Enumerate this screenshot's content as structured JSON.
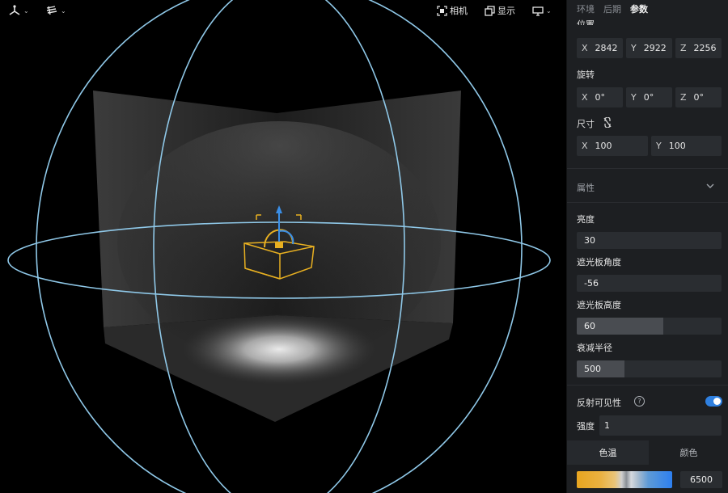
{
  "toolbar": {
    "camera_label": "相机",
    "display_label": "显示"
  },
  "panel": {
    "tabs": [
      {
        "label": "环境",
        "active": false
      },
      {
        "label": "后期",
        "active": false
      },
      {
        "label": "参数",
        "active": true
      }
    ],
    "position": {
      "label": "位置",
      "x": "2842",
      "y": "2922",
      "z": "2256"
    },
    "rotation": {
      "label": "旋转",
      "x": "0°",
      "y": "0°",
      "z": "0°"
    },
    "size": {
      "label": "尺寸",
      "x": "100",
      "y": "100"
    },
    "axes": {
      "x": "X",
      "y": "Y",
      "z": "Z"
    },
    "properties": {
      "header": "属性",
      "brightness": {
        "label": "亮度",
        "value": "30",
        "fill": 0.0
      },
      "shade_angle": {
        "label": "遮光板角度",
        "value": "-56",
        "fill": 0.0
      },
      "shade_height": {
        "label": "遮光板高度",
        "value": "60",
        "fill": 0.6
      },
      "falloff_radius": {
        "label": "衰减半径",
        "value": "500",
        "fill": 0.33
      }
    },
    "reflection": {
      "label": "反射可见性",
      "help": "?",
      "enabled": true
    },
    "intensity": {
      "label": "强度",
      "value": "1"
    },
    "color_tabs": {
      "temperature": "色温",
      "color": "颜色"
    },
    "color_temperature": "6500"
  },
  "colors": {
    "accent": "#2f80e0",
    "gizmo_yellow": "#e8b021",
    "gizmo_blue": "#3a8ee6",
    "guide_circle": "#8fc8e8"
  }
}
